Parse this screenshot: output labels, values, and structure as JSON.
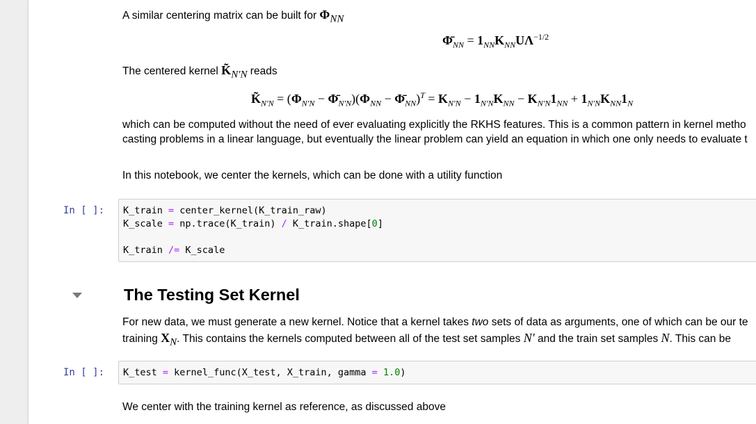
{
  "markdown": {
    "p1_text": "A similar centering matrix can be built for ",
    "p2_text_before": "The centered kernel ",
    "p2_text_after": " reads",
    "p3_line1": "which can be computed without the need of ever evaluating explicitly the RKHS features. This is a common pattern in kernel metho",
    "p3_line2": "casting problems in a linear language, but eventually the linear problem can yield an equation in which one only needs to evaluate t",
    "p4_text": "In this notebook, we center the kernels, which can be done with a utility function",
    "section_heading": "The Testing Set Kernel",
    "p5_line1_a": "For new data, we must generate a new kernel. Notice that a kernel takes ",
    "p5_line1_em": "two",
    "p5_line1_b": " sets of data as arguments, one of which can be our te",
    "p5_line2_a": "training ",
    "p5_line2_b": ". This contains the kernels computed between all of the test set samples ",
    "p5_line2_c": " and the train set samples ",
    "p5_line2_d": ". This can be",
    "p6_text": "We center with the training kernel as reference, as discussed above"
  },
  "cells": {
    "prompt": "In [ ]:",
    "cell1": {
      "l1_a": "K_train ",
      "l1_op": "=",
      "l1_b": " center_kernel(K_train_raw)",
      "l2_a": "K_scale ",
      "l2_op": "=",
      "l2_b": " np.trace(K_train) ",
      "l2_op2": "/",
      "l2_c": " K_train.shape[",
      "l2_num": "0",
      "l2_d": "]",
      "l3_a": "K_train ",
      "l3_op": "/=",
      "l3_b": " K_scale"
    },
    "cell2": {
      "l1_a": "K_test ",
      "l1_op": "=",
      "l1_b": " kernel_func(X_test, X_train, gamma ",
      "l1_op2": "=",
      "l1_sp": " ",
      "l1_num": "1.0",
      "l1_c": ")"
    }
  },
  "colors": {
    "prompt": "#303f9f",
    "operator": "#aa22ff",
    "number": "#008000",
    "cell_background": "#f7f7f7",
    "page_background": "#eeeeee"
  },
  "icons": {
    "collapse": "caret-down-icon"
  }
}
